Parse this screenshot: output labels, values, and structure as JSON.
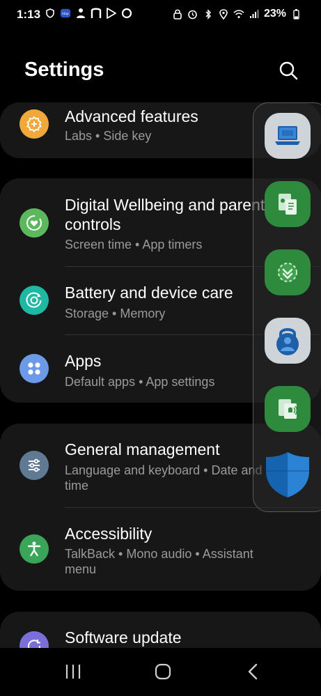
{
  "status": {
    "time": "1:13",
    "battery": "23%",
    "left_icons": [
      "shield-icon",
      "app-badge-icon",
      "person-icon",
      "netflix-icon",
      "play-store-icon",
      "circle-icon"
    ],
    "right_icons": [
      "lock-icon",
      "alarm-icon",
      "bluetooth-icon",
      "location-icon",
      "wifi-icon",
      "signal-icon",
      "battery-icon"
    ]
  },
  "header": {
    "title": "Settings",
    "search_icon": "search-icon"
  },
  "items": [
    {
      "title": "Advanced features",
      "subtitle": "Labs  •  Side key",
      "icon": "plus-gear-icon",
      "icon_color": "#f0a83a"
    },
    {
      "title": "Digital Wellbeing and parental controls",
      "subtitle": "Screen time  •  App timers",
      "icon": "heart-circle-icon",
      "icon_color": "#5cb85c"
    },
    {
      "title": "Battery and device care",
      "subtitle": "Storage  •  Memory",
      "icon": "device-care-icon",
      "icon_color": "#1fb8a3"
    },
    {
      "title": "Apps",
      "subtitle": "Default apps  •  App settings",
      "icon": "apps-grid-icon",
      "icon_color": "#6d9ae8"
    },
    {
      "title": "General management",
      "subtitle": "Language and keyboard  •  Date and time",
      "icon": "sliders-icon",
      "icon_color": "#5f7a92"
    },
    {
      "title": "Accessibility",
      "subtitle": "TalkBack  •  Mono audio  •  Assistant menu",
      "icon": "accessibility-icon",
      "icon_color": "#3aa559"
    },
    {
      "title": "Software update",
      "icon": "update-icon",
      "icon_color": "#7b6ed8"
    }
  ],
  "edge_panel": {
    "apps": [
      {
        "icon": "laptop-icon",
        "bg": "#cfd4d8"
      },
      {
        "icon": "contact-transfer-icon",
        "bg": "#2e8b3e"
      },
      {
        "icon": "download-shield-icon",
        "bg": "#2e8b3e"
      },
      {
        "icon": "authenticator-icon",
        "bg": "#cfd4d8"
      },
      {
        "icon": "notification-share-icon",
        "bg": "#2e8b3e"
      },
      {
        "icon": "defender-shield-icon",
        "bg": "transparent"
      }
    ]
  },
  "navbar": {
    "recents_icon": "recents-icon",
    "home_icon": "home-icon",
    "back_icon": "back-icon"
  }
}
